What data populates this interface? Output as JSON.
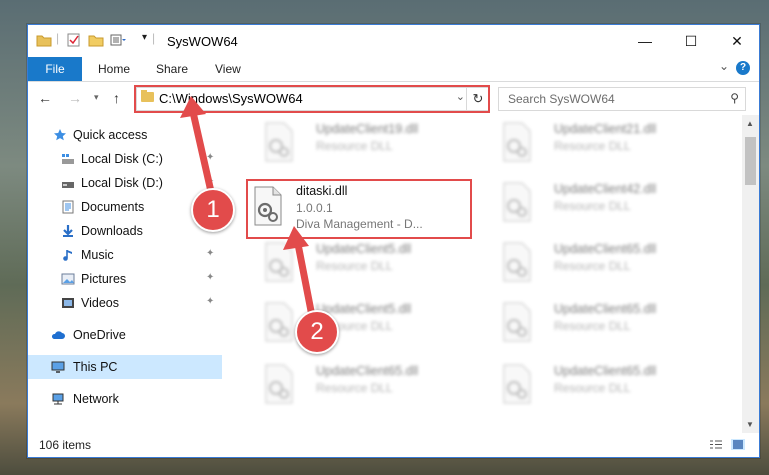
{
  "window": {
    "title": "SysWOW64",
    "controls": {
      "minimize": "—",
      "maximize": "☐",
      "close": "✕"
    }
  },
  "ribbon": {
    "tabs": [
      {
        "label": "File"
      },
      {
        "label": "Home"
      },
      {
        "label": "Share"
      },
      {
        "label": "View"
      }
    ]
  },
  "address": {
    "path": "C:\\Windows\\SysWOW64",
    "search_placeholder": "Search SysWOW64"
  },
  "sidebar": {
    "items": [
      {
        "label": "Quick access"
      },
      {
        "label": "Local Disk (C:)"
      },
      {
        "label": "Local Disk (D:)"
      },
      {
        "label": "Documents"
      },
      {
        "label": "Downloads"
      },
      {
        "label": "Music"
      },
      {
        "label": "Pictures"
      },
      {
        "label": "Videos"
      },
      {
        "label": "OneDrive"
      },
      {
        "label": "This PC"
      },
      {
        "label": "Network"
      }
    ]
  },
  "files": [
    {
      "name": "UpdateClient19.dll",
      "type": "Resource DLL"
    },
    {
      "name": "UpdateClient21.dll",
      "type": "Resource DLL"
    },
    {
      "name": "ditaski.dll",
      "version": "1.0.0.1",
      "desc": "Diva Management - D..."
    },
    {
      "name": "UpdateClient42.dll",
      "type": "Resource DLL"
    },
    {
      "name": "UpdateClient5.dll",
      "type": "Resource DLL"
    },
    {
      "name": "UpdateClient65.dll",
      "type": "Resource DLL"
    },
    {
      "name": "UpdateClient5.dll",
      "type": "Resource DLL"
    },
    {
      "name": "UpdateClient65.dll",
      "type": "Resource DLL"
    },
    {
      "name": "UpdateClient65.dll",
      "type": "Resource DLL"
    },
    {
      "name": "UpdateClient65.dll",
      "type": "Resource DLL"
    }
  ],
  "status": {
    "items": "106 items"
  },
  "callouts": {
    "one": "1",
    "two": "2"
  },
  "colors": {
    "accent": "#1979ca",
    "highlight": "#e24b4b",
    "selected": "#cce8ff"
  }
}
